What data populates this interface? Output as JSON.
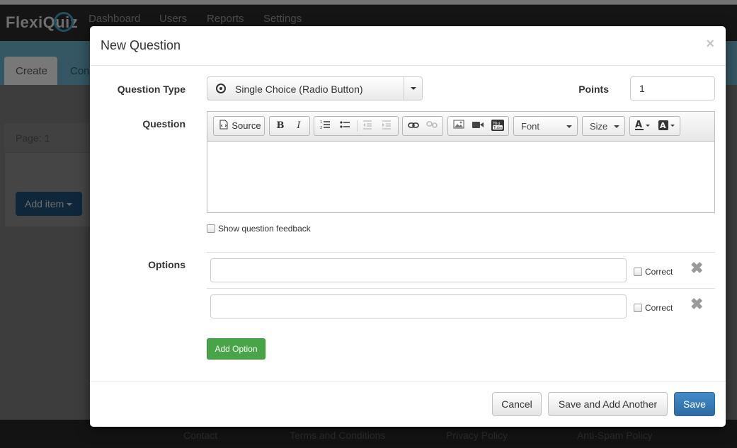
{
  "app": {
    "logo": "FlexiQuiz",
    "nav": [
      "Dashboard",
      "Users",
      "Reports",
      "Settings"
    ],
    "tabs": [
      "Create",
      "Con"
    ],
    "page_label": "Page: 1",
    "add_item_label": "Add item",
    "footer_links": [
      "Contact",
      "Terms and Conditions",
      "Privacy Policy",
      "Anti-Spam Policy"
    ]
  },
  "modal": {
    "title": "New Question",
    "close_glyph": "×",
    "question_type": {
      "label": "Question Type",
      "selected": "Single Choice (Radio Button)"
    },
    "points": {
      "label": "Points",
      "value": "1"
    },
    "question": {
      "label": "Question",
      "toolbar": {
        "source": "Source",
        "bold": "B",
        "italic": "I",
        "font": "Font",
        "size": "Size"
      }
    },
    "show_feedback_label": "Show question feedback",
    "options": {
      "label": "Options",
      "correct_label": "Correct",
      "rows": [
        {
          "value": "",
          "correct": false
        },
        {
          "value": "",
          "correct": false
        }
      ],
      "add_option_label": "Add Option"
    },
    "footer": {
      "cancel": "Cancel",
      "save_add_another": "Save and Add Another",
      "save": "Save"
    }
  }
}
